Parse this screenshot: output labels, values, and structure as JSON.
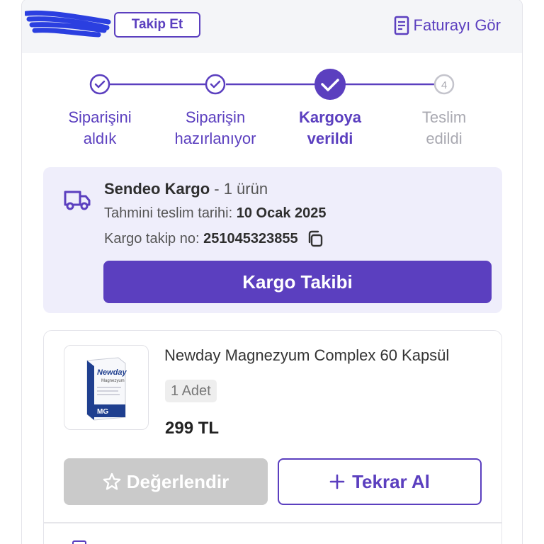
{
  "header": {
    "follow_label": "Takip Et",
    "invoice_label": "Faturayı Gör",
    "invoice_icon": "document-icon"
  },
  "steps": [
    {
      "label_line1": "Siparişini",
      "label_line2": "aldık",
      "state": "done"
    },
    {
      "label_line1": "Siparişin",
      "label_line2": "hazırlanıyor",
      "state": "done"
    },
    {
      "label_line1": "Kargoya",
      "label_line2": "verildi",
      "state": "current"
    },
    {
      "label_line1": "Teslim",
      "label_line2": "edildi",
      "state": "pending",
      "number": "4"
    }
  ],
  "shipment": {
    "carrier": "Sendeo Kargo",
    "item_count": "- 1 ürün",
    "eta_label": "Tahmini teslim tarihi:",
    "eta_value": "10 Ocak 2025",
    "tracking_label": "Kargo takip no:",
    "tracking_number": "251045323855",
    "track_button": "Kargo Takibi",
    "icon": "truck-icon"
  },
  "product": {
    "name": "Newday Magnezyum Complex 60 Kapsül",
    "quantity": "1 Adet",
    "price": "299 TL",
    "rate_button": "Değerlendir",
    "reorder_button": "Tekrar Al",
    "package_brand": "Newday",
    "package_text": "Magnezyum"
  },
  "colors": {
    "accent": "#5b3fbf",
    "panel": "#efeefb",
    "disabled": "#cacaca",
    "pending": "#a9a9b1"
  }
}
